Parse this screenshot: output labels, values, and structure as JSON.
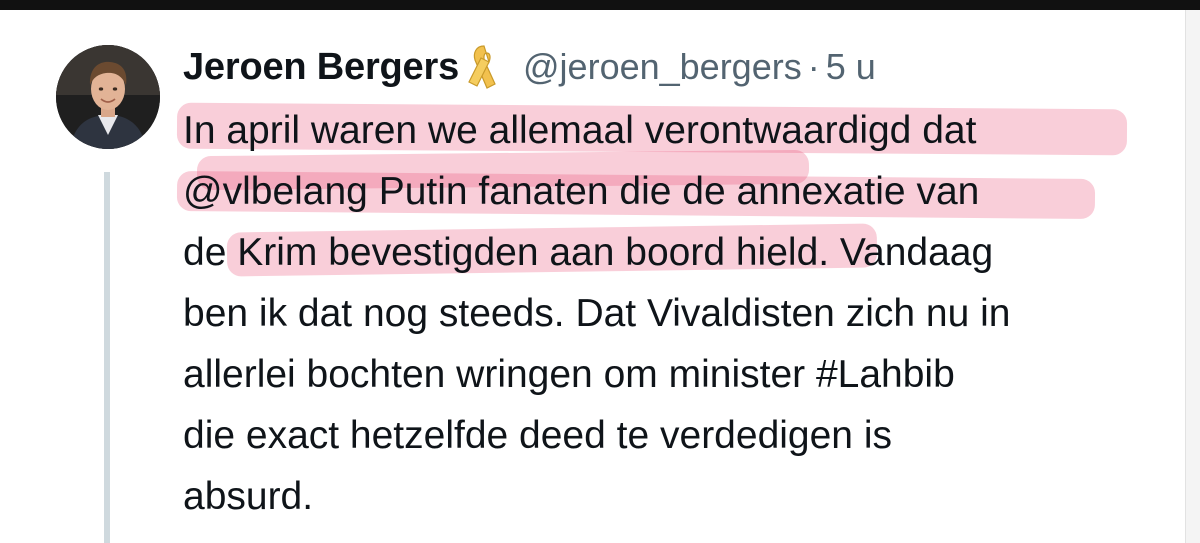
{
  "tweet": {
    "author": {
      "display_name": "Jeroen Bergers",
      "handle": "@jeroen_bergers",
      "badge_icon": "yellow-ribbon-icon"
    },
    "separator": "·",
    "timestamp": "5 u",
    "text_lines": [
      "In april waren we allemaal verontwaardigd dat",
      "@vlbelang Putin fanaten die de annexatie van",
      "de Krim bevestigden aan boord hield. Vandaag",
      "ben ik dat nog steeds. Dat Vivaldisten zich nu in",
      "allerlei bochten wringen om minister #Lahbib",
      "die exact hetzelfde deed te verdedigen is",
      "absurd."
    ]
  },
  "colors": {
    "highlight": "#e85078",
    "text": "#0f1419",
    "secondary_text": "#536471",
    "thread_line": "#cfd9de",
    "ribbon": "#f2c14e"
  }
}
